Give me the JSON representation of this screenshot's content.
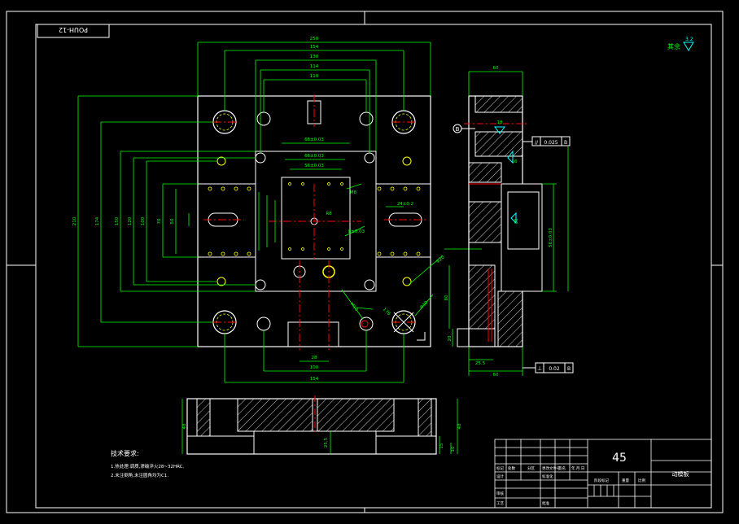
{
  "colors": {
    "background": "#000000",
    "outline": "#ffffff",
    "dimension": "#00ff00",
    "centerline": "#ff0000",
    "bolt_circle": "#ffff00",
    "symbol": "#00ffff"
  },
  "title_stamp": "POUH-12",
  "roughness_note": {
    "label": "其余",
    "value": "3.2"
  },
  "plan_dims": {
    "d250": "250",
    "d154": "154",
    "d130": "130",
    "d114": "114",
    "d110": "110",
    "d176": "176",
    "d68": "68±0.03",
    "d66": "66±0.03",
    "d56": "56±0.03",
    "d28": "28",
    "d100": "100",
    "d154b": "154",
    "side1": "210",
    "side2": "174",
    "side3": "150",
    "side4": "120",
    "side5": "100",
    "side6": "70",
    "side7": "50",
    "slot": "24±0.2",
    "chamfer": "8±0.03",
    "m8": "M8",
    "m10": "M10",
    "r8": "R8",
    "d30": "Φ30",
    "d20": "Φ20"
  },
  "section_dims": {
    "top60": "60",
    "bot60": "60",
    "w25": "25.5",
    "h20": "20",
    "h16": "16",
    "h18": "18",
    "h38": "38",
    "h80": "80",
    "vert": "56±0.03"
  },
  "tolerance_parallel": {
    "symbol": "//",
    "value": "0.025",
    "datum": "B"
  },
  "tolerance_perp": {
    "symbol": "⊥",
    "value": "0.02",
    "datum": "B"
  },
  "datum_label": "B",
  "bottom_dims": {
    "h1": "48",
    "h2": "48",
    "h3": "25.5",
    "h4": "15",
    "h5": "10"
  },
  "notes": {
    "title": "技术要求:",
    "line1": "1.热处理:调质,渗碳淬火28~32HRC.",
    "line2": "2.未注倒角,未注圆角均为C1."
  },
  "title_block": {
    "material": "45",
    "part_name": "动模板",
    "scale_label": "比例",
    "row_labels": [
      "标记",
      "处数",
      "分区",
      "更改文件号",
      "签名",
      "年.月.日"
    ],
    "design": "设计",
    "standard": "标准化",
    "check": "审核",
    "process": "工艺",
    "approve": "批准",
    "stage_mark": "阶段标记",
    "weight": "重量",
    "scale": "比例"
  }
}
